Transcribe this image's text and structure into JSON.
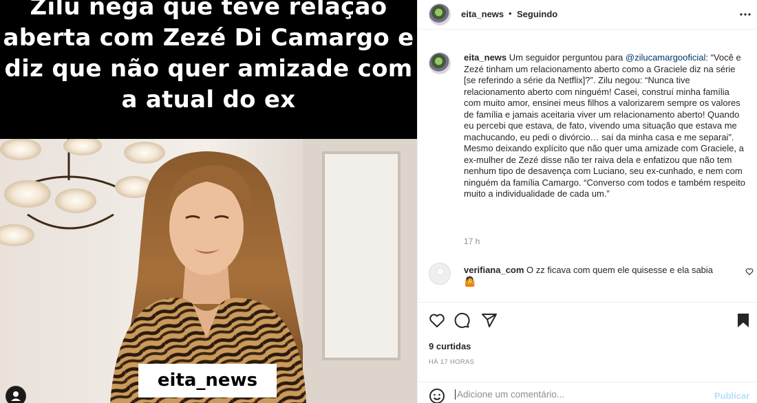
{
  "post_image": {
    "headline": "Zilu nega que teve relação aberta com Zezé Di Camargo e diz que não quer amizade com a atual do ex",
    "watermark": "eita_news"
  },
  "header": {
    "username": "eita_news",
    "separator": "•",
    "follow_status": "Seguindo",
    "more_icon": "more-horizontal-icon"
  },
  "caption": {
    "username": "eita_news",
    "text_before_mention": " Um seguidor perguntou para ",
    "mention": "@zilucamargooficial",
    "text_after_mention": ": “Você e Zezé tinham um relacionamento aberto como a Graciele diz na série [se referindo a série da Netflix]?”. Zilu negou: “Nunca tive relacionamento aberto com ninguém! Casei, construí minha família com muito amor, ensinei meus filhos a valorizarem sempre os valores de família e jamais aceitaria viver um relacionamento aberto! Quando eu percebi que estava, de fato, vivendo uma situação que estava me machucando, eu pedi o divórcio… saí da minha casa e me separai”. Mesmo deixando explícito que não quer uma amizade com Graciele, a ex-mulher de Zezé disse não ter raiva dela e enfatizou que não tem nenhum tipo de desavença com Luciano, seu ex-cunhado, e nem com ninguém da família Camargo. “Converso com todos e também respeito muito a individualidade de cada um.”",
    "time": "17 h"
  },
  "comments": [
    {
      "username": "verifiana_com",
      "text": " O zz ficava com quem ele quisesse e ela sabia",
      "emoji": "🤷"
    }
  ],
  "actions": {
    "likes": "9 curtidas",
    "posted_ago": "HÁ 17 HORAS",
    "icons": [
      "heart-icon",
      "comment-icon",
      "share-icon",
      "bookmark-icon"
    ]
  },
  "add_comment": {
    "placeholder": "Adicione um comentário...",
    "publish_label": "Publicar"
  },
  "colors": {
    "link": "#00376b",
    "muted": "#8e8e8e",
    "publish_disabled": "#b2dffc",
    "border": "#efefef"
  }
}
